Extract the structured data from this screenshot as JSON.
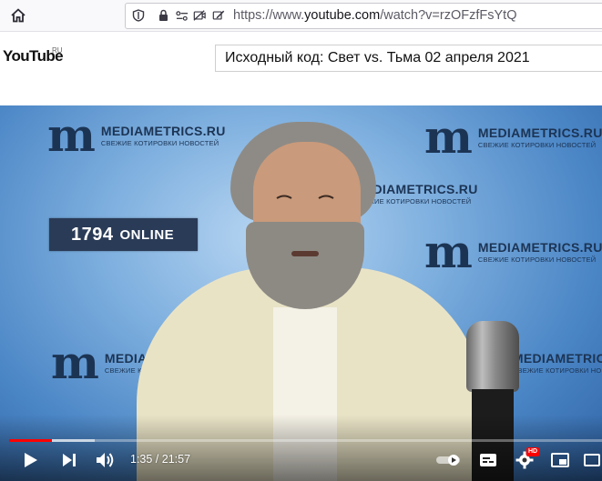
{
  "browser": {
    "url_prefix": "https://www.",
    "url_host": "youtube.com",
    "url_path": "/watch?v=rzOFzfFsYtQ"
  },
  "header": {
    "logo": "YouTube",
    "logo_region": "RU",
    "search_value": "Исходный код: Свет vs. Тьма 02 апреля 2021"
  },
  "video": {
    "watermark_brand": "MEDIAMETRICS.RU",
    "watermark_tagline": "СВЕЖИЕ КОТИРОВКИ НОВОСТЕЙ",
    "watermark_letter": "m",
    "online_count": "1794",
    "online_label": "ONLINE"
  },
  "player": {
    "current_time": "1:35",
    "duration": "21:57",
    "time_display": "1:35 / 21:57",
    "progress_fraction": 0.072,
    "buffered_fraction": 0.145,
    "quality_badge": "HD"
  },
  "colors": {
    "progress_played": "#ff0000",
    "brand_navy": "#1c3454"
  },
  "icons": {
    "toolbar": [
      "home-icon",
      "shield-icon",
      "lock-icon",
      "permissions-icon",
      "camera-blocked-icon",
      "edit-icon"
    ],
    "controls": [
      "play-icon",
      "next-icon",
      "volume-icon",
      "autoplay-toggle",
      "subtitles-icon",
      "settings-icon",
      "miniplayer-icon",
      "theater-icon"
    ]
  }
}
